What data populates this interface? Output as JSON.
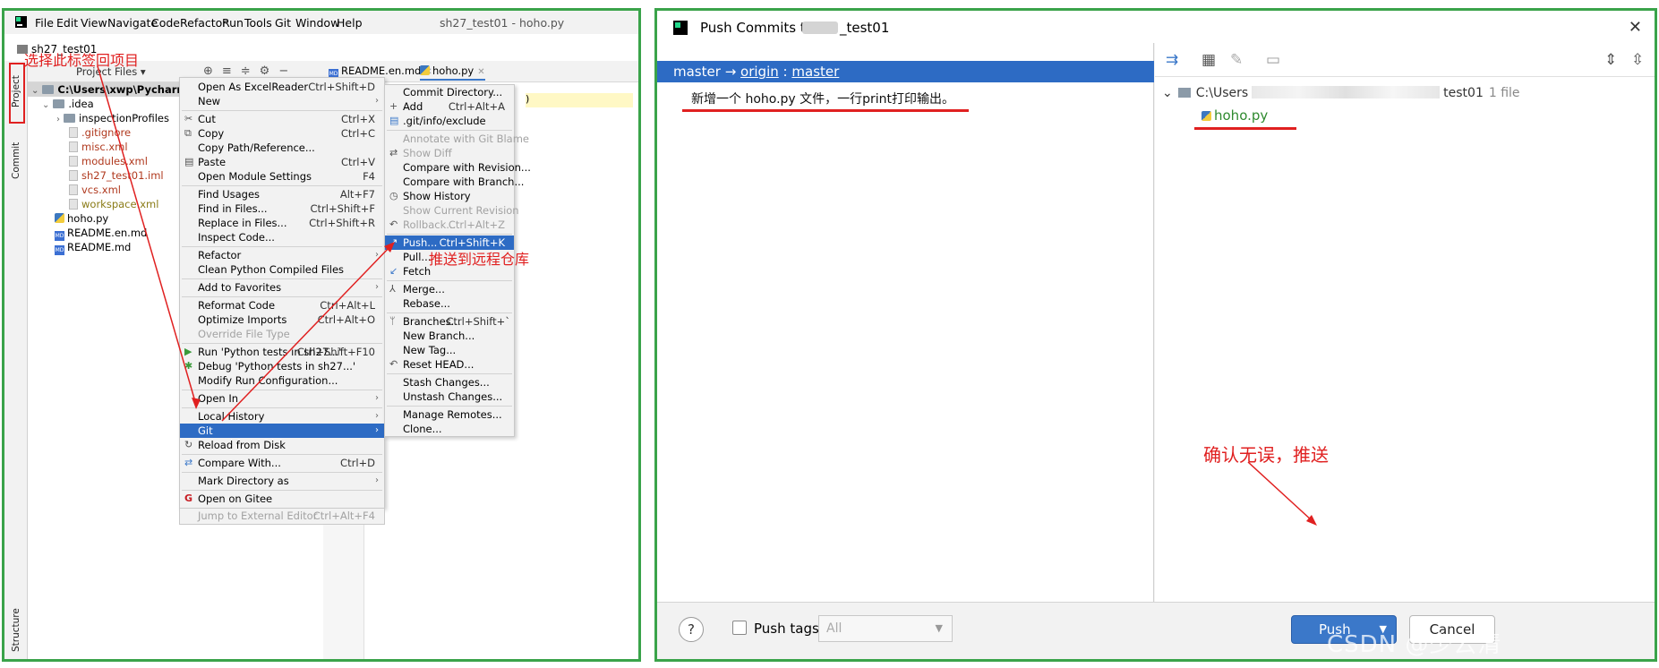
{
  "ide": {
    "menu": [
      "File",
      "Edit",
      "View",
      "Navigate",
      "Code",
      "Refactor",
      "Run",
      "Tools",
      "Git",
      "Window",
      "Help"
    ],
    "window_title": "sh27_test01 - hoho.py",
    "project_name": "sh27_test01",
    "sidebar_tabs": {
      "project": "Project",
      "commit": "Commit",
      "structure": "Structure"
    },
    "toolwindow_title": "Project Files",
    "editor_tabs": [
      {
        "label": "README.en.md"
      },
      {
        "label": "hoho.py"
      }
    ],
    "editor_snippet": ")",
    "tree": {
      "root": "C:\\Users\\xwp\\PycharmProject",
      "idea": ".idea",
      "items": [
        {
          "label": "inspectionProfiles"
        },
        {
          "label": ".gitignore"
        },
        {
          "label": "misc.xml"
        },
        {
          "label": "modules.xml"
        },
        {
          "label": "sh27_test01.iml"
        },
        {
          "label": "vcs.xml"
        },
        {
          "label": "workspace.xml"
        },
        {
          "label": "hoho.py"
        },
        {
          "label": "README.en.md"
        },
        {
          "label": "README.md"
        }
      ]
    },
    "context_menu": [
      {
        "label": "Open As ExcelReader",
        "shortcut": "Ctrl+Shift+D"
      },
      {
        "label": "New"
      },
      {
        "label": "Cut",
        "shortcut": "Ctrl+X"
      },
      {
        "label": "Copy",
        "shortcut": "Ctrl+C"
      },
      {
        "label": "Copy Path/Reference..."
      },
      {
        "label": "Paste",
        "shortcut": "Ctrl+V"
      },
      {
        "label": "Open Module Settings",
        "shortcut": "F4"
      },
      {
        "label": "Find Usages",
        "shortcut": "Alt+F7"
      },
      {
        "label": "Find in Files...",
        "shortcut": "Ctrl+Shift+F"
      },
      {
        "label": "Replace in Files...",
        "shortcut": "Ctrl+Shift+R"
      },
      {
        "label": "Inspect Code..."
      },
      {
        "label": "Refactor"
      },
      {
        "label": "Clean Python Compiled Files"
      },
      {
        "label": "Add to Favorites"
      },
      {
        "label": "Reformat Code",
        "shortcut": "Ctrl+Alt+L"
      },
      {
        "label": "Optimize Imports",
        "shortcut": "Ctrl+Alt+O"
      },
      {
        "label": "Override File Type"
      },
      {
        "label": "Run 'Python tests in sh27...'",
        "shortcut": "Ctrl+Shift+F10"
      },
      {
        "label": "Debug 'Python tests in sh27...'"
      },
      {
        "label": "Modify Run Configuration..."
      },
      {
        "label": "Open In"
      },
      {
        "label": "Local History"
      },
      {
        "label": "Git"
      },
      {
        "label": "Reload from Disk"
      },
      {
        "label": "Compare With...",
        "shortcut": "Ctrl+D"
      },
      {
        "label": "Mark Directory as"
      },
      {
        "label": "Open on Gitee"
      },
      {
        "label": "Jump to External Editor",
        "shortcut": "Ctrl+Alt+F4"
      }
    ],
    "git_menu": [
      {
        "label": "Commit Directory..."
      },
      {
        "label": "Add",
        "shortcut": "Ctrl+Alt+A"
      },
      {
        "label": ".git/info/exclude"
      },
      {
        "label": "Annotate with Git Blame"
      },
      {
        "label": "Show Diff"
      },
      {
        "label": "Compare with Revision..."
      },
      {
        "label": "Compare with Branch..."
      },
      {
        "label": "Show History"
      },
      {
        "label": "Show Current Revision"
      },
      {
        "label": "Rollback...",
        "shortcut": "Ctrl+Alt+Z"
      },
      {
        "label": "Push...",
        "shortcut": "Ctrl+Shift+K"
      },
      {
        "label": "Pull..."
      },
      {
        "label": "Fetch"
      },
      {
        "label": "Merge..."
      },
      {
        "label": "Rebase..."
      },
      {
        "label": "Branches...",
        "shortcut": "Ctrl+Shift+`"
      },
      {
        "label": "New Branch..."
      },
      {
        "label": "New Tag..."
      },
      {
        "label": "Reset HEAD..."
      },
      {
        "label": "Stash Changes..."
      },
      {
        "label": "Unstash Changes..."
      },
      {
        "label": "Manage Remotes..."
      },
      {
        "label": "Clone..."
      }
    ],
    "annotations": {
      "select_tab": "选择此标签回项目",
      "push_to_remote": "推送到远程仓库"
    }
  },
  "push_dialog": {
    "title_prefix": "Push Commits to",
    "title_suffix": "_test01",
    "branch": {
      "local": "master",
      "arrow": "→",
      "remote": "origin",
      "sep": ":",
      "remote_branch": "master"
    },
    "commit_message": "新增一个 hoho.py 文件，一行print打印输出。",
    "repo_path_start": "C:\\Users",
    "repo_path_end": "test01",
    "file_count": "1 file",
    "file": "hoho.py",
    "annotation": "确认无误，推送",
    "help": "?",
    "push_tags_label": "Push tags:",
    "tags_value": "All",
    "push_button": "Push",
    "cancel_button": "Cancel",
    "watermark": "CSDN @少云清"
  },
  "colors": {
    "accent_blue": "#2d6bc4",
    "annotation_red": "#e02020",
    "border_green": "#3aa34a",
    "file_green": "#2f8a2f"
  }
}
